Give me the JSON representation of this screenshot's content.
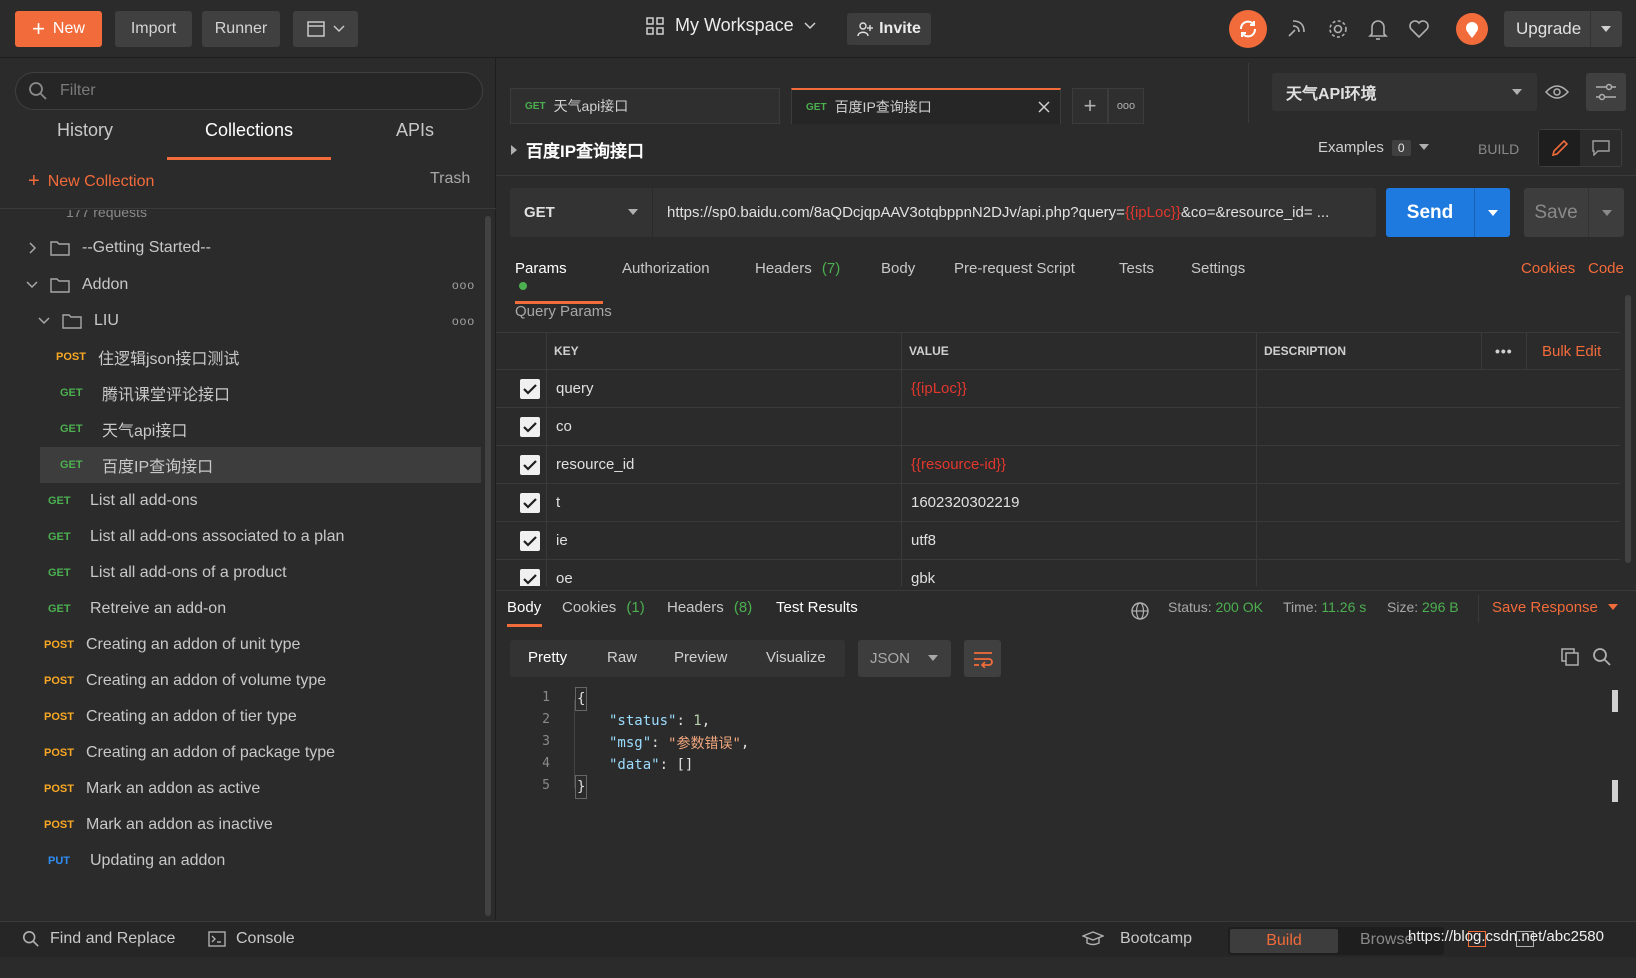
{
  "topbar": {
    "new_label": "New",
    "import_label": "Import",
    "runner_label": "Runner",
    "workspace_label": "My Workspace",
    "invite_label": "Invite",
    "upgrade_label": "Upgrade"
  },
  "sidebar": {
    "filter_placeholder": "Filter",
    "tabs": [
      "History",
      "Collections",
      "APIs"
    ],
    "active_tab": "Collections",
    "new_collection_label": "New Collection",
    "trash_label": "Trash",
    "requests_count": "177 requests",
    "items": [
      {
        "type": "folder",
        "label": "--Getting Started--",
        "expanded": false
      },
      {
        "type": "folder",
        "label": "Addon",
        "expanded": true
      },
      {
        "type": "folder",
        "label": "LIU",
        "expanded": true
      },
      {
        "method": "POST",
        "label": "住逻辑json接口测试"
      },
      {
        "method": "GET",
        "label": "腾讯课堂评论接口"
      },
      {
        "method": "GET",
        "label": "天气api接口"
      },
      {
        "method": "GET",
        "label": "百度IP查询接口",
        "selected": true
      },
      {
        "method": "GET",
        "label": "List all add-ons"
      },
      {
        "method": "GET",
        "label": "List all add-ons associated to a plan"
      },
      {
        "method": "GET",
        "label": "List all add-ons of a product"
      },
      {
        "method": "GET",
        "label": "Retreive an add-on"
      },
      {
        "method": "POST",
        "label": "Creating an addon of unit type"
      },
      {
        "method": "POST",
        "label": "Creating an addon of volume type"
      },
      {
        "method": "POST",
        "label": "Creating an addon of tier type"
      },
      {
        "method": "POST",
        "label": "Creating an addon of package type"
      },
      {
        "method": "POST",
        "label": "Mark an addon as active"
      },
      {
        "method": "POST",
        "label": "Mark an addon as inactive"
      },
      {
        "method": "PUT",
        "label": "Updating an addon"
      }
    ]
  },
  "request_tabs": [
    {
      "method": "GET",
      "label": "天气api接口",
      "active": false
    },
    {
      "method": "GET",
      "label": "百度IP查询接口",
      "active": true
    }
  ],
  "environment": {
    "selected": "天气API环境"
  },
  "request": {
    "title": "百度IP查询接口",
    "examples_label": "Examples",
    "examples_count": "0",
    "build_label": "BUILD",
    "method": "GET",
    "url_prefix": "https://sp0.baidu.com/8aQDcjqpAAV3otqbppnN2DJv/api.php?query=",
    "url_var": "{{ipLoc}}",
    "url_suffix": "&co=&resource_id= ...",
    "send_label": "Send",
    "save_label": "Save"
  },
  "param_tabs": {
    "params": "Params",
    "authorization": "Authorization",
    "headers": "Headers",
    "headers_count": "(7)",
    "body": "Body",
    "prerequest": "Pre-request Script",
    "tests": "Tests",
    "settings": "Settings",
    "cookies": "Cookies",
    "code": "Code"
  },
  "query_params": {
    "title": "Query Params",
    "col_key": "KEY",
    "col_value": "VALUE",
    "col_description": "DESCRIPTION",
    "bulk_edit": "Bulk Edit",
    "rows": [
      {
        "key": "query",
        "value": "{{ipLoc}}",
        "var": true
      },
      {
        "key": "co",
        "value": "",
        "var": false
      },
      {
        "key": "resource_id",
        "value": "{{resource-id}}",
        "var": true
      },
      {
        "key": "t",
        "value": "1602320302219",
        "var": false
      },
      {
        "key": "ie",
        "value": "utf8",
        "var": false
      },
      {
        "key": "oe",
        "value": "gbk",
        "var": false
      }
    ]
  },
  "response": {
    "tabs": {
      "body": "Body",
      "cookies": "Cookies",
      "cookies_count": "(1)",
      "headers": "Headers",
      "headers_count": "(8)",
      "test_results": "Test Results"
    },
    "status_label": "Status:",
    "status_value": "200 OK",
    "time_label": "Time:",
    "time_value": "11.26 s",
    "size_label": "Size:",
    "size_value": "296 B",
    "save_response": "Save Response",
    "formats": [
      "Pretty",
      "Raw",
      "Preview",
      "Visualize"
    ],
    "active_format": "Pretty",
    "language": "JSON",
    "lines": [
      "1",
      "2",
      "3",
      "4",
      "5"
    ],
    "code": {
      "open": "{",
      "k1": "\"status\"",
      "v1": "1",
      "k2": "\"msg\"",
      "v2": "\"参数错误\"",
      "k3": "\"data\"",
      "v3": "[]",
      "close": "}"
    }
  },
  "statusbar": {
    "find_replace": "Find and Replace",
    "console": "Console",
    "bootcamp": "Bootcamp",
    "build": "Build",
    "browse": "Browse",
    "watermark": "https://blog.csdn.net/abc2580"
  },
  "colors": {
    "accent": "#f26b3a",
    "send": "#1f7ae0",
    "get": "#4caf50",
    "post": "#f9a825",
    "put": "#2f8ef4",
    "var": "#e2372d"
  }
}
